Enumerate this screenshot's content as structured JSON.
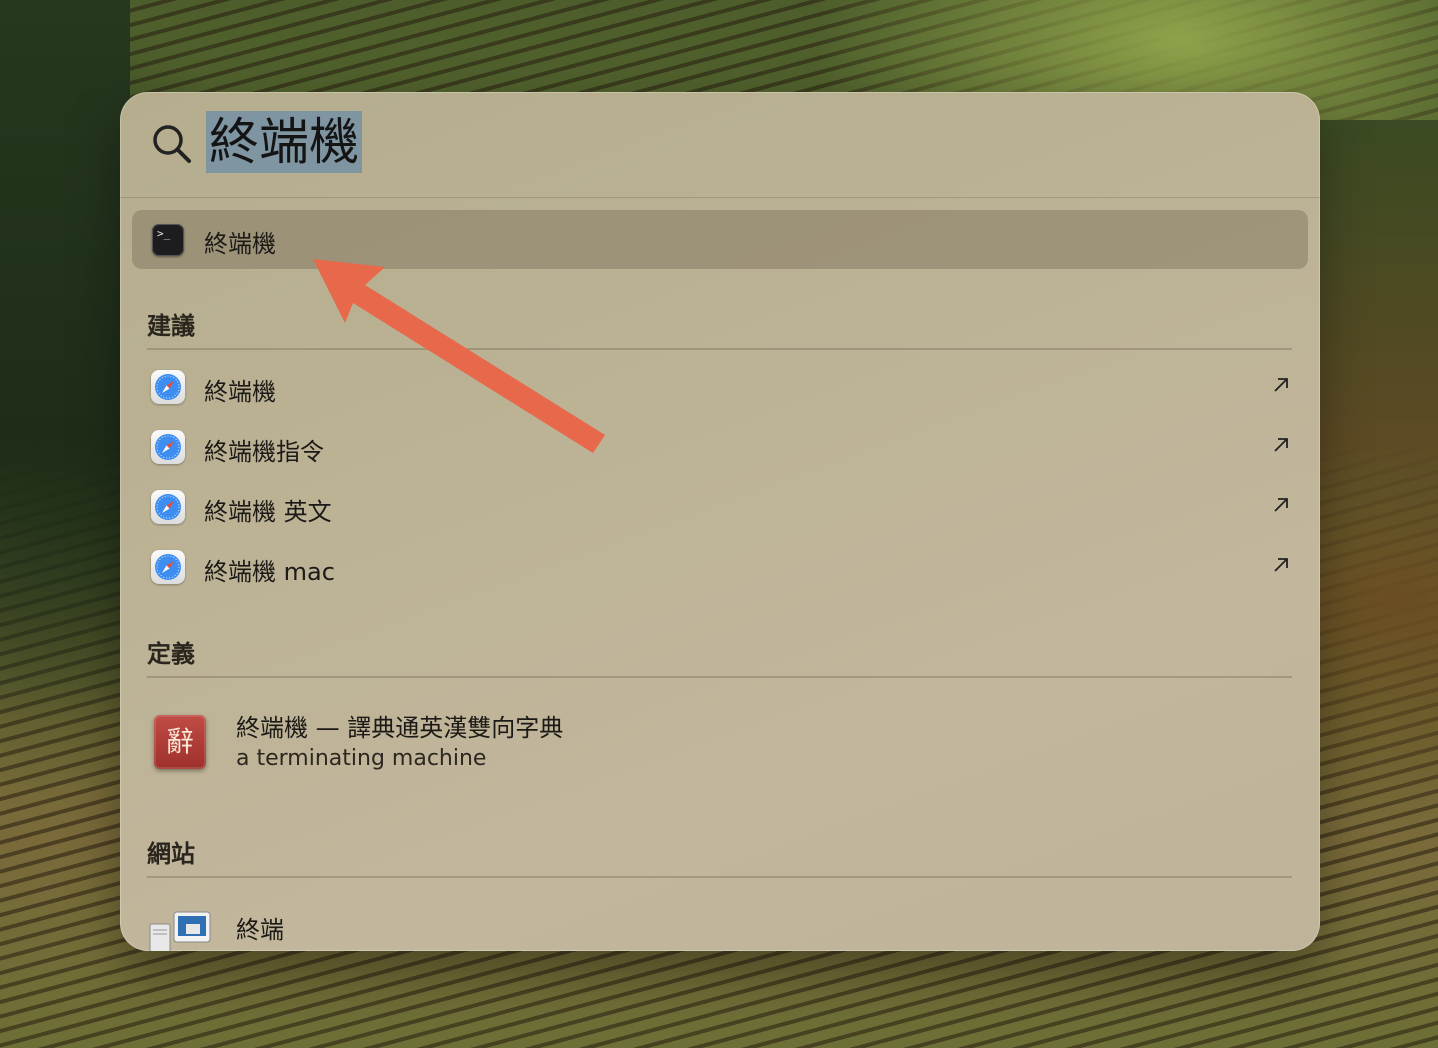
{
  "search": {
    "query": "終端機"
  },
  "top_hit": {
    "label": "終端機",
    "icon": "terminal-icon"
  },
  "sections": {
    "suggestions": {
      "title": "建議",
      "items": [
        {
          "label": "終端機",
          "icon": "safari-icon"
        },
        {
          "label": "終端機指令",
          "icon": "safari-icon"
        },
        {
          "label": "終端機 英文",
          "icon": "safari-icon"
        },
        {
          "label": "終端機 mac",
          "icon": "safari-icon"
        }
      ]
    },
    "definition": {
      "title": "定義",
      "headline": "終端機 — 譯典通英漢雙向字典",
      "subtitle": "a terminating machine",
      "icon_glyph": "辭"
    },
    "websites": {
      "title": "網站",
      "items": [
        {
          "label": "終端",
          "icon": "network-computers-icon"
        }
      ]
    }
  },
  "colors": {
    "selection_highlight": "#7f95a2",
    "annotation_arrow": "#e8684b"
  }
}
